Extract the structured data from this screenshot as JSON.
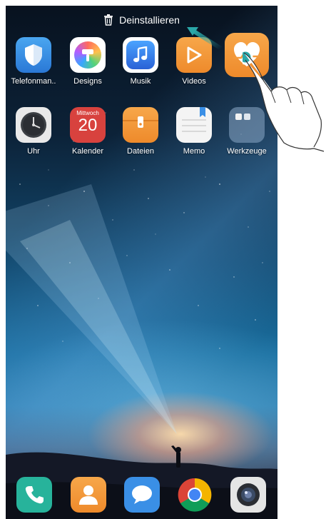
{
  "status_bar": {
    "uninstall_label": "Deinstallieren"
  },
  "home_row1": [
    {
      "label": "Telefonman..",
      "icon": "shield-icon",
      "color": "#3a8fe6"
    },
    {
      "label": "Designs",
      "icon": "brush-icon",
      "color": "#ffffff"
    },
    {
      "label": "Musik",
      "icon": "music-note-icon",
      "color": "#ffffff"
    },
    {
      "label": "Videos",
      "icon": "play-icon",
      "color": "#f39a3c"
    }
  ],
  "health_app": {
    "icon": "heart-icon",
    "color": "#f39a3c"
  },
  "home_row2": [
    {
      "label": "Uhr",
      "icon": "clock-icon",
      "color": "#e9e9e9"
    },
    {
      "label": "Kalender",
      "icon": "calendar-icon",
      "color": "#d8423e",
      "calendar_day": "Mittwoch",
      "calendar_date": "20"
    },
    {
      "label": "Dateien",
      "icon": "folder-icon",
      "color": "#f39a3c"
    },
    {
      "label": "Memo",
      "icon": "note-icon",
      "color": "#f4f4f4"
    },
    {
      "label": "Werkzeuge",
      "icon": "folder-grid-icon",
      "color": "#7a96b4"
    }
  ],
  "dock": [
    {
      "icon": "phone-icon",
      "color": "#27b39b"
    },
    {
      "icon": "contacts-icon",
      "color": "#f39a3c"
    },
    {
      "icon": "chat-bubble-icon",
      "color": "#3a8fe6"
    },
    {
      "icon": "chrome-icon",
      "color": "#ffffff"
    },
    {
      "icon": "camera-icon",
      "color": "#e5e5e5"
    }
  ]
}
